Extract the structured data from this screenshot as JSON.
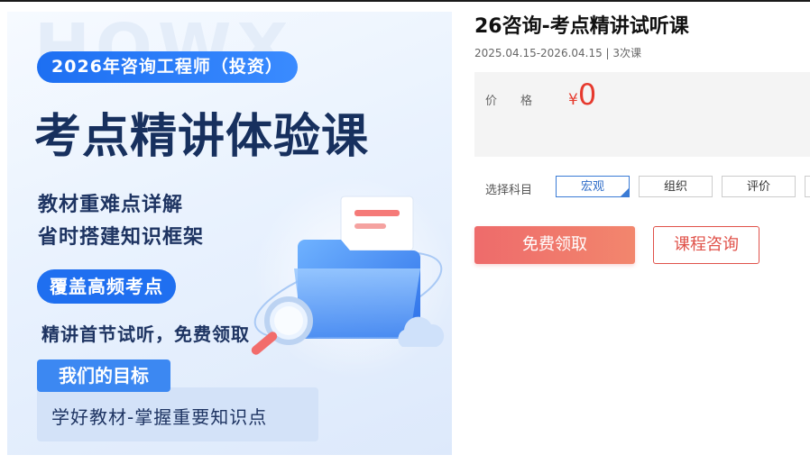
{
  "banner": {
    "watermark": "HOWX",
    "pill_title": "2026年咨询工程师（投资）",
    "big_title": "考点精讲体验课",
    "features": [
      "教材重难点详解",
      "省时搭建知识框架"
    ],
    "cover_pill": "覆盖高频考点",
    "free_line": "精讲首节试听，免费领取",
    "goal_tag": "我们的目标",
    "goal_text": "学好教材-掌握重要知识点"
  },
  "course": {
    "title": "26咨询-考点精讲试听课",
    "meta": "2025.04.15-2026.04.15 | 3次课",
    "price_label": "价格",
    "currency": "¥",
    "price": "0"
  },
  "subjects": {
    "label": "选择科目",
    "items": [
      "宏观",
      "组织",
      "评价"
    ],
    "selected": "宏观"
  },
  "actions": {
    "free_button": "免费领取",
    "consult_button": "课程咨询"
  },
  "colors": {
    "primary_blue": "#1f6ff0",
    "price_red": "#e63a2e",
    "cta_gradient_start": "#ee6b6b",
    "cta_gradient_end": "#f2866d"
  }
}
